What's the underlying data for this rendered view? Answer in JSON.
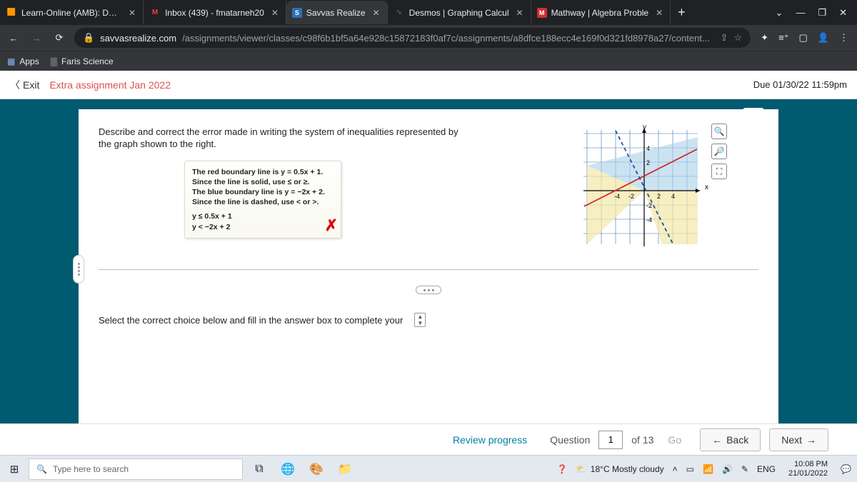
{
  "browser": {
    "tabs": [
      {
        "fav": "🟥",
        "title": "Learn-Online (AMB): Dash"
      },
      {
        "fav": "M",
        "favColor": "#ea4335",
        "title": "Inbox (439) - fmatarneh20"
      },
      {
        "fav": "S",
        "favColor": "#fff",
        "favBg": "#2c6fb3",
        "title": "Savvas Realize",
        "active": true
      },
      {
        "fav": "📈",
        "title": "Desmos | Graphing Calcul"
      },
      {
        "fav": "M",
        "favColor": "#fff",
        "favBg": "#d12f2f",
        "title": "Mathway | Algebra Proble"
      }
    ],
    "url_host": "savvasrealize.com",
    "url_path": "/assignments/viewer/classes/c98f6b1bf5a64e928c15872183f0af7c/assignments/a8dfce188ecc4e169f0d321fd8978a27/content...",
    "bookmarks": [
      {
        "icon": "▦",
        "label": "Apps"
      },
      {
        "icon": "▇",
        "label": "Faris Science"
      }
    ]
  },
  "header": {
    "exit": "Exit",
    "title": "Extra assignment Jan 2022",
    "due": "Due 01/30/22 11:59pm"
  },
  "question": {
    "prompt": "Describe and correct the error made in writing the system of inequalities represented by the graph shown to the right.",
    "note_l1": "The red boundary line is y = 0.5x + 1.",
    "note_l2": "Since the line is solid, use ≤ or ≥.",
    "note_l3": "The blue boundary line is y = −2x + 2.",
    "note_l4": "Since the line is dashed, use < or >.",
    "note_w1": "y ≤ 0.5x + 1",
    "note_w2": "y < −2x + 2",
    "choice": "Select the correct choice below and fill in the answer box to complete your",
    "axis_x": "x",
    "axis_y": "y",
    "ticks": [
      "-4",
      "-2",
      "2",
      "4"
    ]
  },
  "nav": {
    "review": "Review progress",
    "question": "Question",
    "current": "1",
    "of": "of 13",
    "go": "Go",
    "back": "Back",
    "next": "Next"
  },
  "taskbar": {
    "search": "Type here to search",
    "weather": "18°C Mostly cloudy",
    "lang": "ENG",
    "time": "10:08 PM",
    "date": "21/01/2022"
  }
}
